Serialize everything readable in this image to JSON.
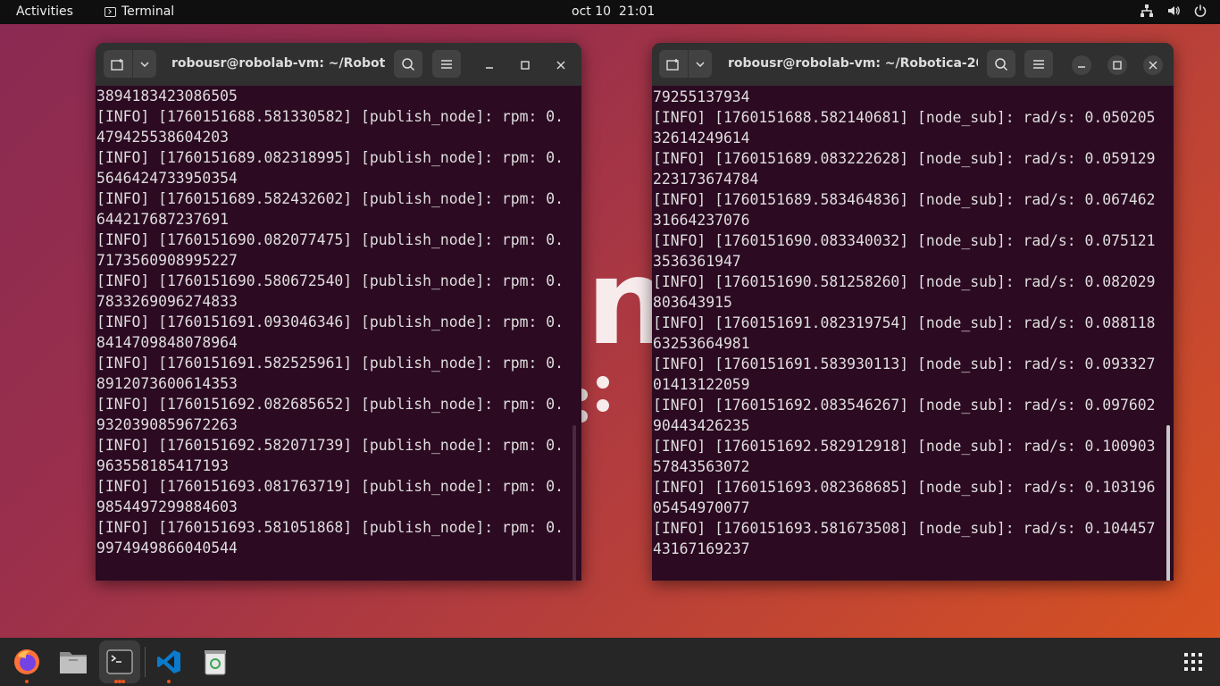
{
  "topbar": {
    "activities": "Activities",
    "app_name": "Terminal",
    "clock": "oct 10  21:01",
    "icons": [
      "network-icon",
      "volume-icon",
      "power-icon"
    ]
  },
  "wallpaper": {
    "logo_text": "ubuntu",
    "version_hint": "2"
  },
  "left_terminal": {
    "title": "robousr@robolab-vm: ~/Robot...",
    "lines": [
      "3894183423086505",
      "[INFO] [1760151688.581330582] [publish_node]: rpm: 0.",
      "479425538604203",
      "[INFO] [1760151689.082318995] [publish_node]: rpm: 0.",
      "5646424733950354",
      "[INFO] [1760151689.582432602] [publish_node]: rpm: 0.",
      "644217687237691",
      "[INFO] [1760151690.082077475] [publish_node]: rpm: 0.",
      "7173560908995227",
      "[INFO] [1760151690.580672540] [publish_node]: rpm: 0.",
      "7833269096274833",
      "[INFO] [1760151691.093046346] [publish_node]: rpm: 0.",
      "8414709848078964",
      "[INFO] [1760151691.582525961] [publish_node]: rpm: 0.",
      "8912073600614353",
      "[INFO] [1760151692.082685652] [publish_node]: rpm: 0.",
      "9320390859672263",
      "[INFO] [1760151692.582071739] [publish_node]: rpm: 0.",
      "963558185417193",
      "[INFO] [1760151693.081763719] [publish_node]: rpm: 0.",
      "9854497299884603",
      "[INFO] [1760151693.581051868] [publish_node]: rpm: 0.",
      "9974949866040544"
    ]
  },
  "right_terminal": {
    "title": "robousr@robolab-vm: ~/Robotica-20...",
    "lines": [
      "79255137934",
      "[INFO] [1760151688.582140681] [node_sub]: rad/s: 0.050205",
      "32614249614",
      "[INFO] [1760151689.083222628] [node_sub]: rad/s: 0.059129",
      "223173674784",
      "[INFO] [1760151689.583464836] [node_sub]: rad/s: 0.067462",
      "31664237076",
      "[INFO] [1760151690.083340032] [node_sub]: rad/s: 0.075121",
      "3536361947",
      "[INFO] [1760151690.581258260] [node_sub]: rad/s: 0.082029",
      "803643915",
      "[INFO] [1760151691.082319754] [node_sub]: rad/s: 0.088118",
      "63253664981",
      "[INFO] [1760151691.583930113] [node_sub]: rad/s: 0.093327",
      "01413122059",
      "[INFO] [1760151692.083546267] [node_sub]: rad/s: 0.097602",
      "90443426235",
      "[INFO] [1760151692.582912918] [node_sub]: rad/s: 0.100903",
      "57843563072",
      "[INFO] [1760151693.082368685] [node_sub]: rad/s: 0.103196",
      "05454970077",
      "[INFO] [1760151693.581673508] [node_sub]: rad/s: 0.104457",
      "43167169237"
    ]
  },
  "dock": {
    "items": [
      {
        "name": "firefox-icon",
        "running": true,
        "active": false
      },
      {
        "name": "files-icon",
        "running": false,
        "active": false
      },
      {
        "name": "terminal-icon",
        "running": true,
        "active": true
      },
      {
        "name": "vscode-icon",
        "running": true,
        "active": false
      },
      {
        "name": "trash-icon",
        "running": false,
        "active": false
      }
    ],
    "show_apps": "app-grid-icon"
  }
}
